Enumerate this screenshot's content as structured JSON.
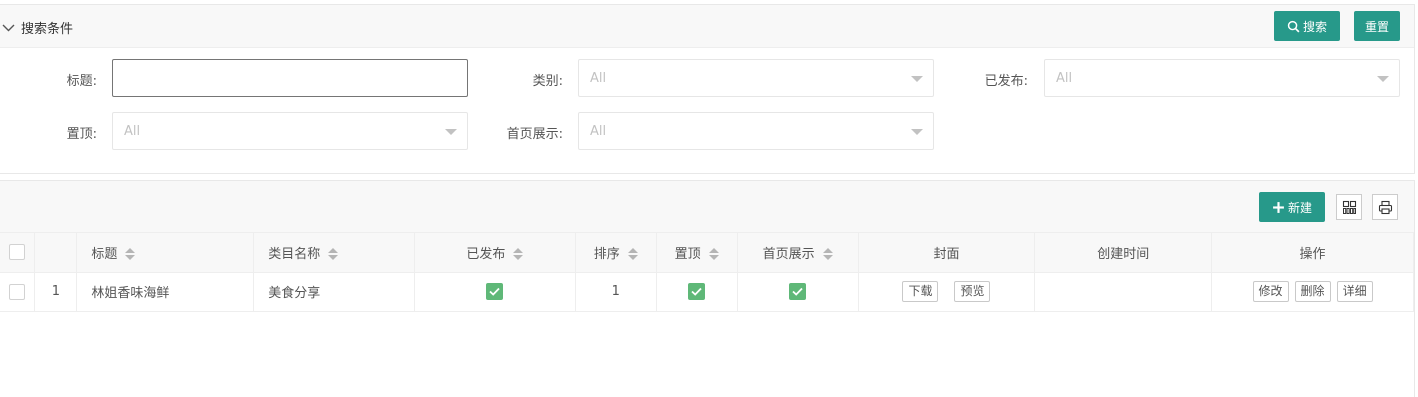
{
  "search": {
    "toggle_label": "搜索条件",
    "search_button": "搜索",
    "reset_button": "重置",
    "fields": {
      "title_label": "标题:",
      "title_value": "",
      "category_label": "类别:",
      "category_value": "All",
      "published_label": "已发布:",
      "published_value": "All",
      "pinned_label": "置顶:",
      "pinned_value": "All",
      "homepage_label": "首页展示:",
      "homepage_value": "All"
    }
  },
  "toolbar": {
    "new_button": "新建",
    "columns_icon": "columns-icon",
    "print_icon": "print-icon"
  },
  "table": {
    "columns": {
      "title": "标题",
      "category": "类目名称",
      "published": "已发布",
      "sort": "排序",
      "pinned": "置顶",
      "homepage": "首页展示",
      "cover": "封面",
      "created": "创建时间",
      "actions": "操作"
    },
    "rows": [
      {
        "index": "1",
        "title": "林姐香味海鲜",
        "category": "美食分享",
        "published": true,
        "sort": "1",
        "pinned": true,
        "homepage": true,
        "cover_download": "下载",
        "cover_preview": "预览",
        "created": "",
        "action_edit": "修改",
        "action_delete": "删除",
        "action_detail": "详细"
      }
    ]
  },
  "colors": {
    "primary": "#27998a",
    "checked": "#5fb878"
  }
}
